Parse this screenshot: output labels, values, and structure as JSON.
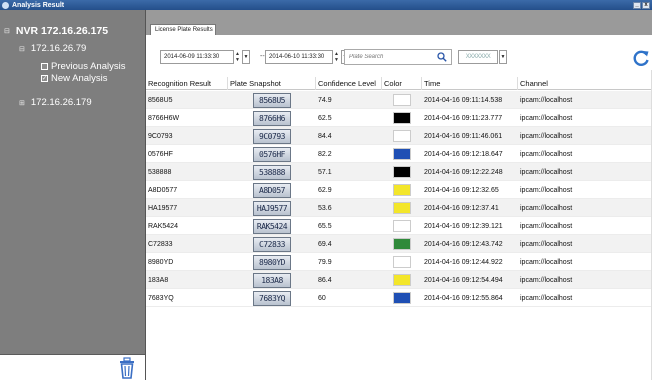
{
  "window": {
    "title": "Analysis Result",
    "min": "_",
    "close": "x"
  },
  "sidebar": {
    "root": {
      "expander": "⊟",
      "label": "NVR 172.16.26.175"
    },
    "nodes": [
      {
        "expander": "⊟",
        "label": "172.16.26.79"
      },
      {
        "expander": "⊞",
        "label": "172.16.26.179"
      }
    ],
    "options": [
      {
        "label": "Previous Analysis",
        "checked": false,
        "mark": ""
      },
      {
        "label": "New Analysis",
        "checked": true,
        "mark": "✓"
      }
    ]
  },
  "tabs": [
    {
      "label": "License Plate Results"
    }
  ],
  "toolbar": {
    "from": "2014-06-09 11:33:30",
    "to": "2014-06-10 11:33:30",
    "separator": "--",
    "search_placeholder": "Plate Search",
    "color_filter": "XXXXXXX"
  },
  "columns": [
    "Recognition Result",
    "Plate Snapshot",
    "Confidence Level",
    "Color",
    "Time",
    "Channel"
  ],
  "rows": [
    {
      "result": "8568U5",
      "plate": "8568U5",
      "confidence": "74.9",
      "color": "#ffffff",
      "time": "2014-04-16 09:11:14.538",
      "channel": "ipcam://localhost"
    },
    {
      "result": "8766H6W",
      "plate": "8766H6",
      "confidence": "62.5",
      "color": "#000000",
      "time": "2014-04-16 09:11:23.777",
      "channel": "ipcam://localhost"
    },
    {
      "result": "9C0793",
      "plate": "9C0793",
      "confidence": "84.4",
      "color": "#ffffff",
      "time": "2014-04-16 09:11:46.061",
      "channel": "ipcam://localhost"
    },
    {
      "result": "0576HF",
      "plate": "0576HF",
      "confidence": "82.2",
      "color": "#1f4fb4",
      "time": "2014-04-16 09:12:18.647",
      "channel": "ipcam://localhost"
    },
    {
      "result": "538888",
      "plate": "538888",
      "confidence": "57.1",
      "color": "#000000",
      "time": "2014-04-16 09:12:22.248",
      "channel": "ipcam://localhost"
    },
    {
      "result": "A8D0577",
      "plate": "A8D057",
      "confidence": "62.9",
      "color": "#f3e62a",
      "time": "2014-04-16 09:12:32.65",
      "channel": "ipcam://localhost"
    },
    {
      "result": "HA19577",
      "plate": "HAJ9577",
      "confidence": "53.6",
      "color": "#f3e62a",
      "time": "2014-04-16 09:12:37.41",
      "channel": "ipcam://localhost"
    },
    {
      "result": "RAK5424",
      "plate": "RAK5424",
      "confidence": "65.5",
      "color": "#ffffff",
      "time": "2014-04-16 09:12:39.121",
      "channel": "ipcam://localhost"
    },
    {
      "result": "C72833",
      "plate": "C72833",
      "confidence": "69.4",
      "color": "#2f8a3a",
      "time": "2014-04-16 09:12:43.742",
      "channel": "ipcam://localhost"
    },
    {
      "result": "8980YD",
      "plate": "8980YD",
      "confidence": "79.9",
      "color": "#ffffff",
      "time": "2014-04-16 09:12:44.922",
      "channel": "ipcam://localhost"
    },
    {
      "result": "183A8",
      "plate": "183A8",
      "confidence": "86.4",
      "color": "#f3e62a",
      "time": "2014-04-16 09:12:54.494",
      "channel": "ipcam://localhost"
    },
    {
      "result": "7683YQ",
      "plate": "7683YQ",
      "confidence": "60",
      "color": "#1f4fb4",
      "time": "2014-04-16 09:12:55.864",
      "channel": "ipcam://localhost"
    }
  ]
}
